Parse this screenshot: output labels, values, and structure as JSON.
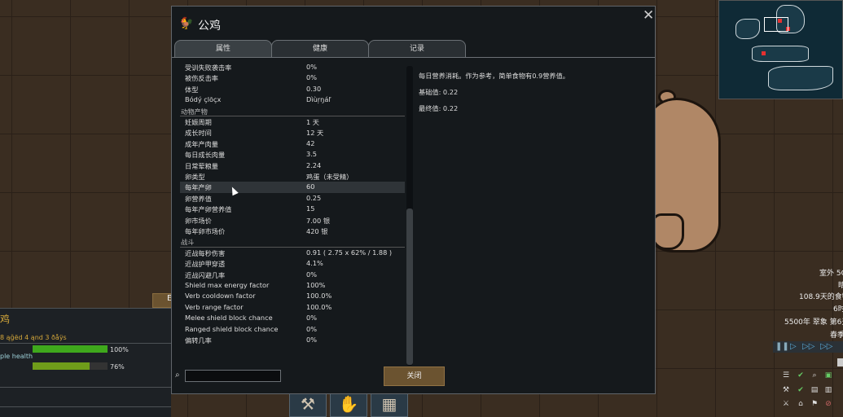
{
  "dialog": {
    "title": "公鸡",
    "icon": "rooster-icon",
    "close_symbol": "✕",
    "tabs": [
      {
        "label": "属性",
        "active": true
      },
      {
        "label": "健康",
        "active": false
      },
      {
        "label": "记录",
        "active": false
      }
    ],
    "rows_top": [
      {
        "label": "受训失败袭击率",
        "value": "0%"
      },
      {
        "label": "被伤反击率",
        "value": "0%"
      },
      {
        "label": "体型",
        "value": "0.30"
      },
      {
        "label": "Bódý çlõçx",
        "value": "Dìùŗŋáľ"
      }
    ],
    "category_animal": "动物产物",
    "rows_animal": [
      {
        "label": "妊娠周期",
        "value": "1 天"
      },
      {
        "label": "成长时间",
        "value": "12 天"
      },
      {
        "label": "成年产肉量",
        "value": "42"
      },
      {
        "label": "每日成长肉量",
        "value": "3.5"
      },
      {
        "label": "日常荤粮量",
        "value": "2.24"
      },
      {
        "label": "卵类型",
        "value": "鸡蛋（未受精）"
      },
      {
        "label": "每年产卵",
        "value": "60"
      },
      {
        "label": "卵营养值",
        "value": "0.25"
      },
      {
        "label": "每年产卵营养值",
        "value": "15"
      },
      {
        "label": "卵市场价",
        "value": "7.00 银"
      },
      {
        "label": "每年卵市场价",
        "value": "420 银"
      }
    ],
    "category_combat": "战斗",
    "rows_combat": [
      {
        "label": "近战每秒伤害",
        "value": "0.91 ( 2.75 x 62% / 1.88 )"
      },
      {
        "label": "近战护甲穿透",
        "value": "4.1%"
      },
      {
        "label": "近战闪避几率",
        "value": "0%"
      },
      {
        "label": "Shield max energy factor",
        "value": "100%"
      },
      {
        "label": "Verb cooldown factor",
        "value": "100.0%"
      },
      {
        "label": "Verb range factor",
        "value": "100.0%"
      },
      {
        "label": "Melee shield block chance",
        "value": "0%"
      },
      {
        "label": "Ranged shield block chance",
        "value": "0%"
      },
      {
        "label": "偏转几率",
        "value": "0%"
      }
    ],
    "description": {
      "line1": "每日营养消耗。作为参考，简单食物有0.9营养值。",
      "line2": "基础值: 0.22",
      "line3": "最终值: 0.22"
    },
    "search": {
      "value": "",
      "icon": "search-icon"
    },
    "close_button_label": "关闭"
  },
  "pawn_panel": {
    "name": "鸡",
    "subtitle": "8 ąğëd 4 ąnd 3 ðåÿs",
    "bars": [
      {
        "label": "ple health",
        "percent": 100,
        "value_text": "100%",
        "color": "#3fa81c"
      },
      {
        "label": "",
        "percent": 76,
        "value_text": "76%",
        "color": "#6f9c1a"
      }
    ],
    "side_button": "E"
  },
  "status": {
    "outdoor": "室外 5C",
    "line2": "晴",
    "food": "108.9天的食物",
    "hour": "6时",
    "date": "5500年 翠象 第6天",
    "season": "春季"
  },
  "colors": {
    "dialog_bg": "#15191c",
    "accent_button": "#6b5330",
    "pawn_name": "#d4a73a"
  }
}
